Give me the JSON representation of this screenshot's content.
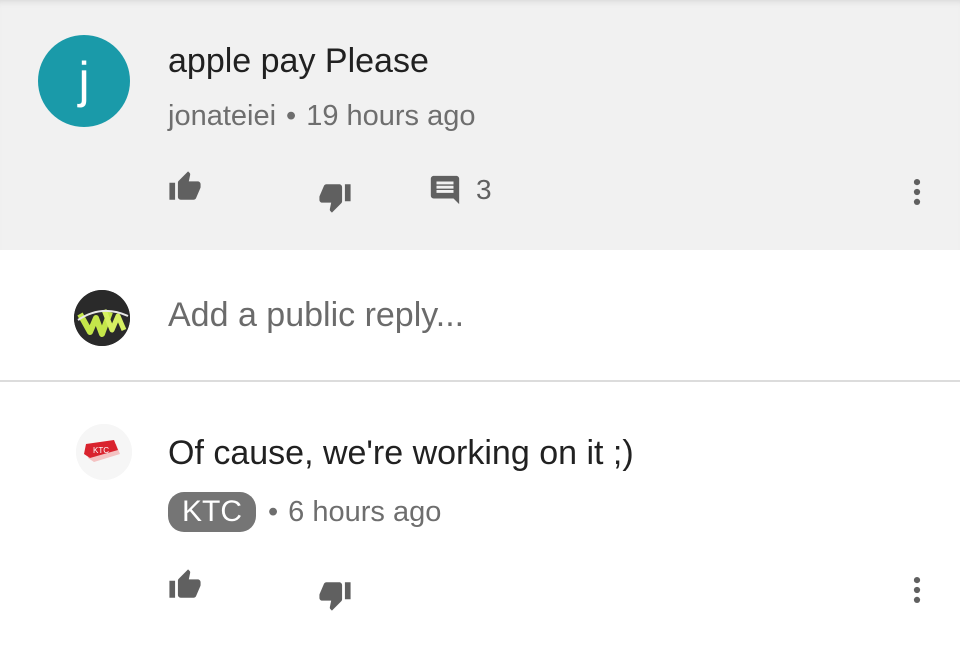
{
  "comment": {
    "avatar_letter": "j",
    "avatar_color": "#1a9aa9",
    "text": "apple pay Please",
    "author": "jonateiei",
    "separator": "•",
    "time": "19 hours ago",
    "reply_count": "3",
    "icons": [
      "thumbs-up-icon",
      "thumbs-down-icon",
      "reply-icon",
      "more-vert-icon"
    ]
  },
  "reply_box": {
    "placeholder": "Add a public reply..."
  },
  "reply": {
    "avatar_label": "KTC",
    "text": "Of cause, we're working on it ;)",
    "author": "KTC",
    "separator": "•",
    "time": "6 hours ago",
    "icons": [
      "thumbs-up-icon",
      "thumbs-down-icon",
      "more-vert-icon"
    ]
  },
  "colors": {
    "comment_background": "#f1f1f1",
    "icon_gray": "#606060",
    "badge_gray": "#757575",
    "brand_red": "#d9232e"
  }
}
